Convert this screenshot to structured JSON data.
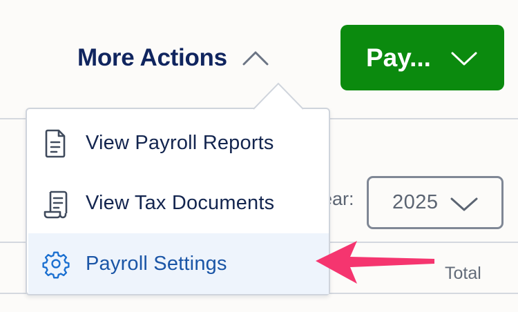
{
  "header": {
    "more_actions_label": "More Actions",
    "pay_button_label": "Pay..."
  },
  "filters": {
    "year_label": "ear:",
    "year_value": "2025"
  },
  "table": {
    "columns": [
      "Total"
    ]
  },
  "dropdown": {
    "items": [
      {
        "label": "View Payroll Reports",
        "icon": "document-icon"
      },
      {
        "label": "View Tax Documents",
        "icon": "scroll-icon"
      },
      {
        "label": "Payroll Settings",
        "icon": "gear-icon",
        "highlighted": true
      }
    ]
  },
  "colors": {
    "brand_navy": "#10255f",
    "pay_green": "#0b8a0e",
    "highlight_bg": "#eef4fc",
    "highlight_text": "#1a55a6",
    "annotation_arrow": "#f5356f"
  }
}
